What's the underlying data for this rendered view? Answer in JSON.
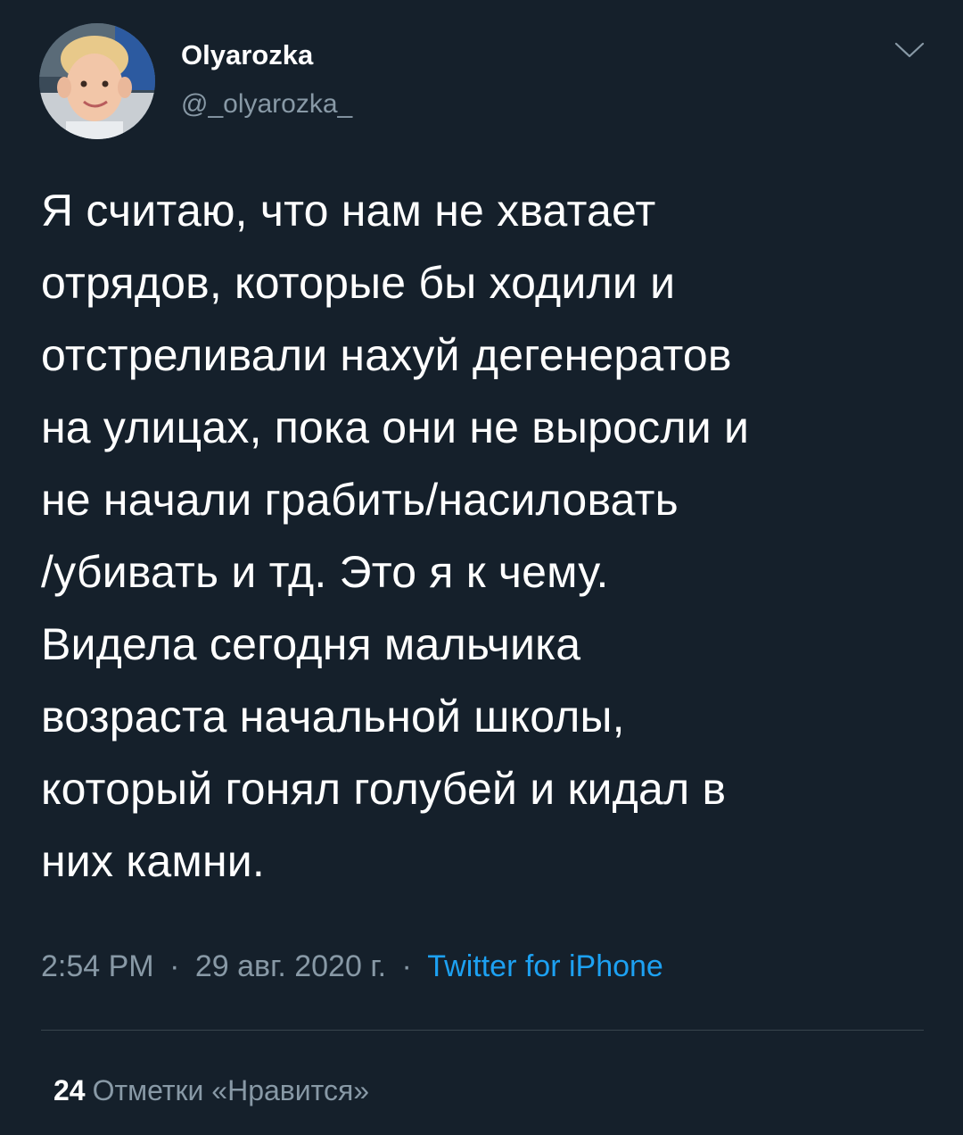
{
  "author": {
    "display_name": "Olyarozka",
    "handle": "@_olyarozka_"
  },
  "icons": {
    "avatar": "profile-photo",
    "menu": "chevron-down-icon"
  },
  "tweet": {
    "lines": [
      "Я считаю, что нам не хватает",
      "отрядов, которые бы ходили и",
      "отстреливали нахуй дегенератов",
      "на улицах, пока они не выросли и",
      "не начали грабить/насиловать",
      "/убивать и тд. Это я к чему.",
      "Видела сегодня мальчика",
      "возраста начальной школы,",
      "который гонял голубей и кидал в",
      "них камни."
    ]
  },
  "meta": {
    "time": "2:54 PM",
    "separator": "·",
    "date": "29 авг. 2020 г.",
    "source": "Twitter for iPhone"
  },
  "stats": {
    "likes_count": "24",
    "likes_label": "Отметки «Нравится»"
  },
  "colors": {
    "background": "#15202b",
    "text_primary": "#ffffff",
    "text_secondary": "#8899a6",
    "link": "#1da1f2",
    "divider": "#38444d"
  }
}
